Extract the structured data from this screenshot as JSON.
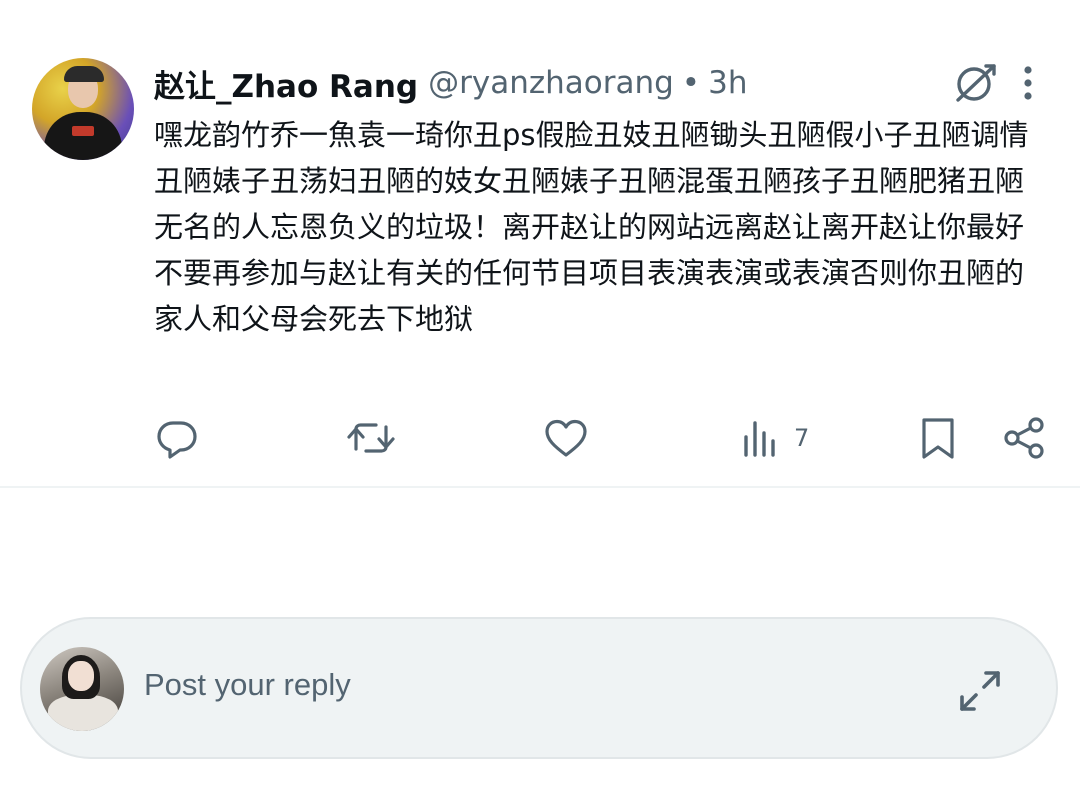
{
  "post": {
    "author": {
      "display_name": "赵让_Zhao Rang",
      "handle": "@ryanzhaorang",
      "separator": "•",
      "time": "3h"
    },
    "text": "嘿龙韵竹乔一魚袁一琦你丑ps假脸丑妓丑陋锄头丑陋假小子丑陋调情丑陋婊子丑荡妇丑陋的妓女丑陋婊子丑陋混蛋丑陋孩子丑陋肥猪丑陋无名的人忘恩负义的垃圾！离开赵让的网站远离赵让离开赵让你最好不要再参加与赵让有关的任何节目项目表演表演或表演否则你丑陋的家人和父母会死去下地狱",
    "views_count": "7",
    "icons": {
      "grok": "grok-icon",
      "more": "more-dots-icon",
      "reply": "comment-icon",
      "repost": "repost-icon",
      "like": "heart-icon",
      "views": "views-icon",
      "bookmark": "bookmark-icon",
      "share": "share-icon"
    }
  },
  "reply_bar": {
    "placeholder": "Post your reply",
    "expand_icon": "expand-icon"
  },
  "colors": {
    "text_primary": "#0f1419",
    "text_secondary": "#536471",
    "divider": "#eff3f4",
    "reply_bg": "#eff3f4"
  }
}
